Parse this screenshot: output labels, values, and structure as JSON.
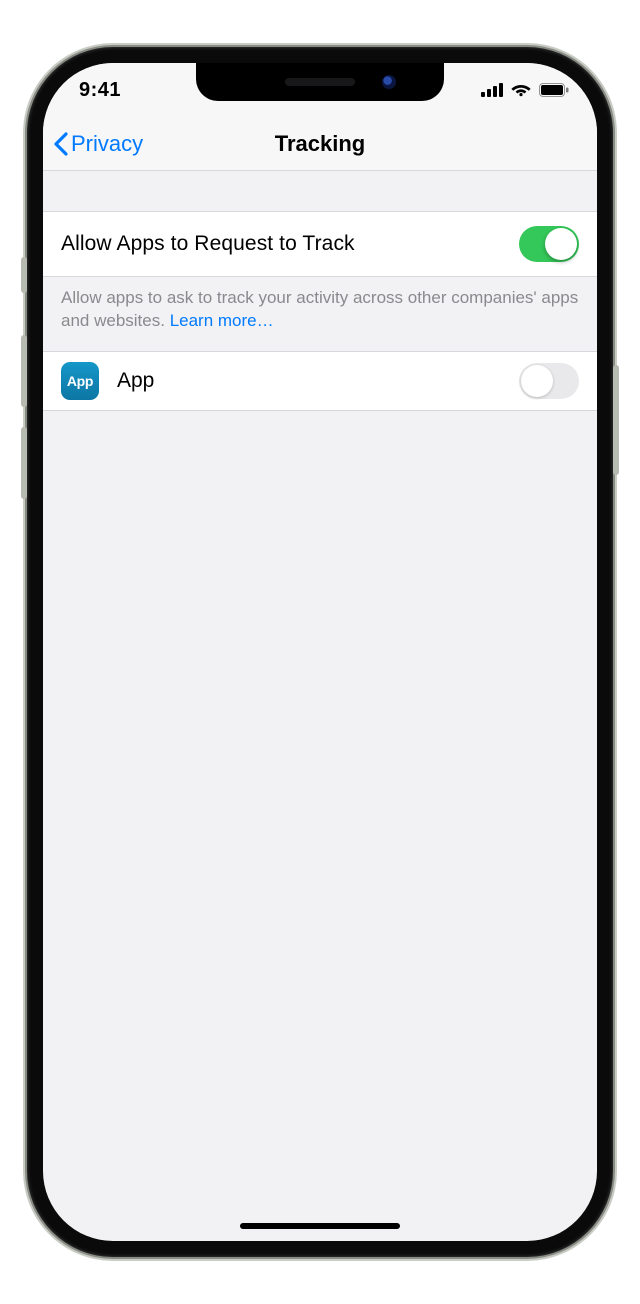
{
  "status": {
    "time": "9:41"
  },
  "nav": {
    "back": "Privacy",
    "title": "Tracking"
  },
  "allow_row": {
    "label": "Allow Apps to Request to Track",
    "enabled": true
  },
  "footer": {
    "text": "Allow apps to ask to track your activity across other companies' apps and websites. ",
    "link": "Learn more…"
  },
  "app_row": {
    "icon_label": "App",
    "name": "App",
    "enabled": false
  }
}
